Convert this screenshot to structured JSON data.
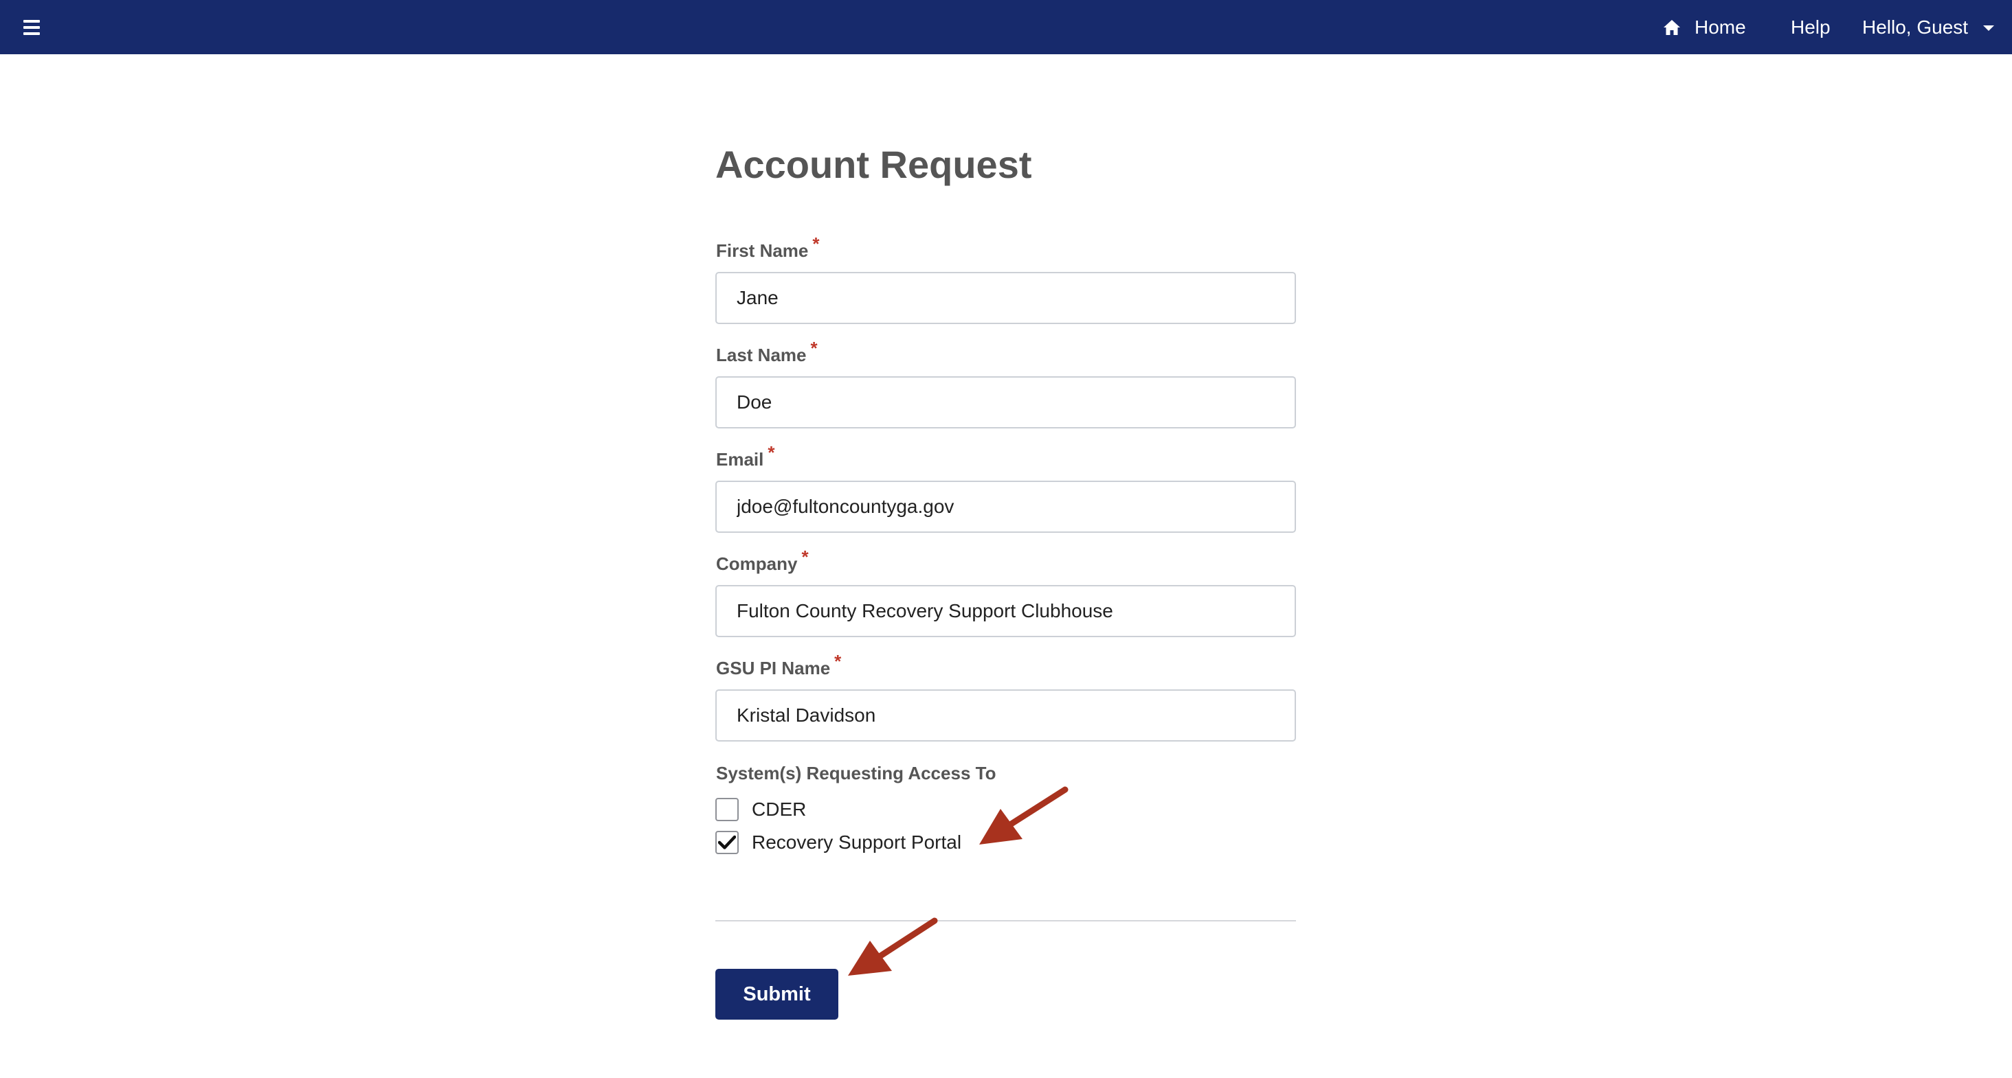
{
  "nav": {
    "menu_icon": "hamburger-menu-icon",
    "home_icon": "home-icon",
    "home_label": "Home",
    "help_label": "Help",
    "user_label": "Hello, Guest",
    "user_caret_icon": "caret-down-icon",
    "bar_color": "#172a6c"
  },
  "form": {
    "title": "Account Request",
    "required_marker": "*",
    "fields": [
      {
        "label": "First Name",
        "value": "Jane"
      },
      {
        "label": "Last Name",
        "value": "Doe"
      },
      {
        "label": "Email",
        "value": "jdoe@fultoncountyga.gov"
      },
      {
        "label": "Company",
        "value": "Fulton County Recovery Support Clubhouse"
      },
      {
        "label": "GSU PI Name",
        "value": "Kristal Davidson"
      }
    ],
    "systems_label": "System(s) Requesting Access To",
    "systems": [
      {
        "label": "CDER",
        "checked": false
      },
      {
        "label": "Recovery Support Portal",
        "checked": true
      }
    ],
    "submit_label": "Submit",
    "accent_color": "#172a6c",
    "required_color": "#c0392b",
    "annotation_arrow_color": "#a8321e"
  }
}
